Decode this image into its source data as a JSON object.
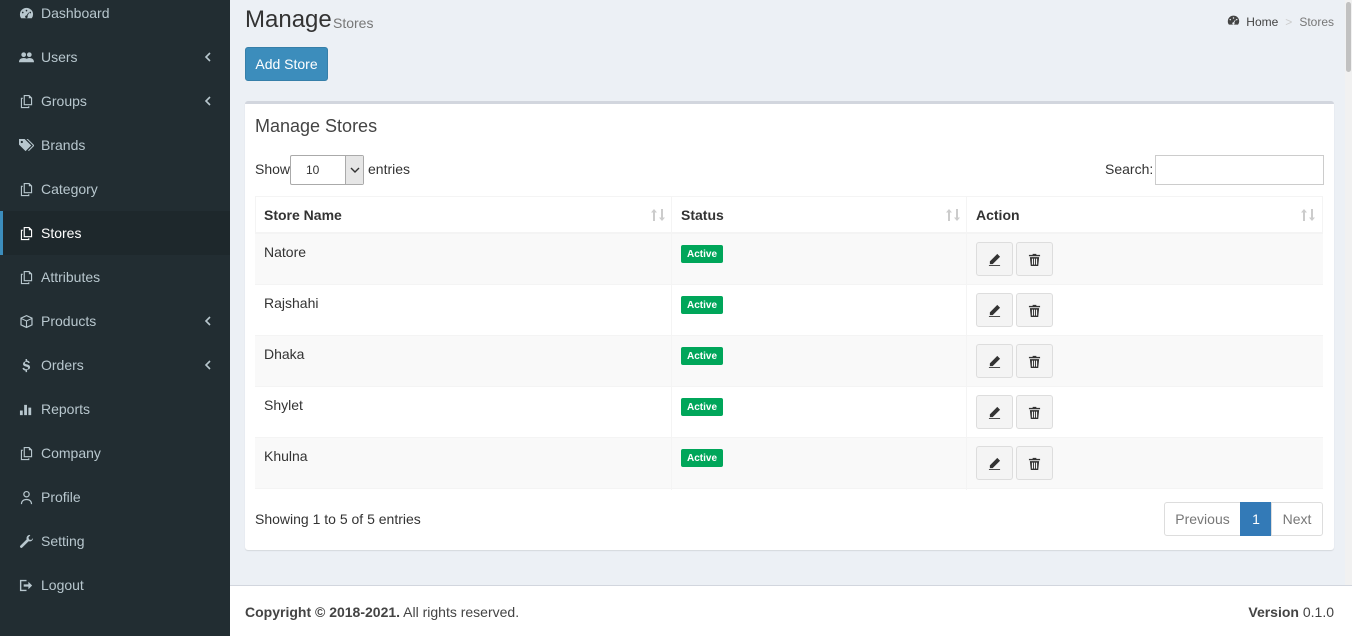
{
  "sidebar": {
    "items": [
      {
        "label": "Dashboard",
        "icon": "dashboard-icon"
      },
      {
        "label": "Users",
        "icon": "users-icon",
        "has_children": true
      },
      {
        "label": "Groups",
        "icon": "copy-icon",
        "has_children": true
      },
      {
        "label": "Brands",
        "icon": "tags-icon"
      },
      {
        "label": "Category",
        "icon": "copy-icon"
      },
      {
        "label": "Stores",
        "icon": "copy-icon",
        "active": true
      },
      {
        "label": "Attributes",
        "icon": "copy-icon"
      },
      {
        "label": "Products",
        "icon": "cube-icon",
        "has_children": true
      },
      {
        "label": "Orders",
        "icon": "dollar-icon",
        "has_children": true
      },
      {
        "label": "Reports",
        "icon": "bar-chart-icon"
      },
      {
        "label": "Company",
        "icon": "copy-icon"
      },
      {
        "label": "Profile",
        "icon": "user-icon"
      },
      {
        "label": "Setting",
        "icon": "wrench-icon"
      },
      {
        "label": "Logout",
        "icon": "sign-out-icon"
      }
    ]
  },
  "header": {
    "title": "Manage",
    "subtitle": "Stores",
    "breadcrumb": {
      "home": "Home",
      "separator": ">",
      "current": "Stores"
    }
  },
  "add_button": "Add Store",
  "box": {
    "title": "Manage Stores",
    "show_label": "Show",
    "entries_label": "entries",
    "page_length": "10",
    "search_label": "Search:",
    "search_value": ""
  },
  "table": {
    "columns": [
      "Store Name",
      "Status",
      "Action"
    ],
    "rows": [
      {
        "name": "Natore",
        "status": "Active"
      },
      {
        "name": "Rajshahi",
        "status": "Active"
      },
      {
        "name": "Dhaka",
        "status": "Active"
      },
      {
        "name": "Shylet",
        "status": "Active"
      },
      {
        "name": "Khulna",
        "status": "Active"
      }
    ]
  },
  "pagination": {
    "info": "Showing 1 to 5 of 5 entries",
    "previous": "Previous",
    "current": "1",
    "next": "Next"
  },
  "footer": {
    "copyright_bold": "Copyright © 2018-2021.",
    "copyright_rest": " All rights reserved.",
    "version_label": "Version",
    "version_value": " 0.1.0"
  },
  "colors": {
    "sidebar_bg": "#222d32",
    "sidebar_active_bg": "#1e282c",
    "accent": "#3c8dbc",
    "badge_green": "#00a65a",
    "page_bg": "#ecf0f5"
  }
}
